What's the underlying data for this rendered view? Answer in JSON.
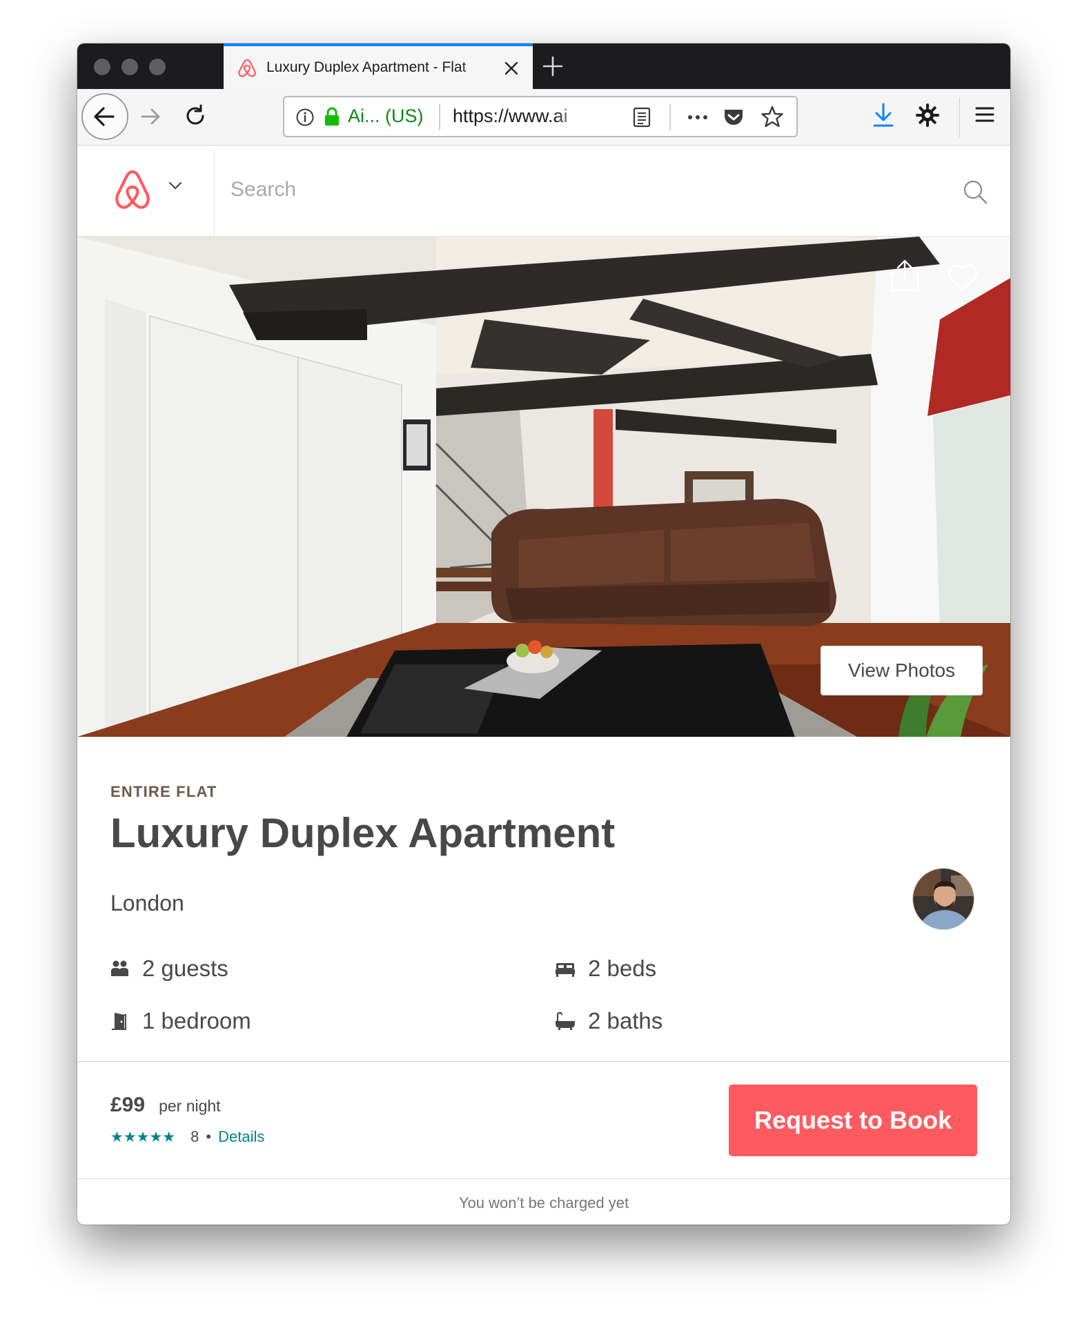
{
  "browser": {
    "tab_title": "Luxury Duplex Apartment - Flat",
    "url_identity": "Ai... (US)",
    "url_text": "https://www.ai"
  },
  "site": {
    "search_placeholder": "Search",
    "brand_color": "#FF5A5F"
  },
  "hero": {
    "view_photos_label": "View Photos"
  },
  "listing": {
    "type": "ENTIRE FLAT",
    "title": "Luxury Duplex Apartment",
    "city": "London",
    "amenities": {
      "guests": "2 guests",
      "beds": "2 beds",
      "bedroom": "1 bedroom",
      "baths": "2 baths"
    }
  },
  "booking": {
    "price": "£99",
    "price_unit": "per night",
    "stars": "★★★★★",
    "star_rating": 5,
    "review_count": "8",
    "separator": "•",
    "details_label": "Details",
    "book_label": "Request to Book",
    "footer_note": "You won’t be charged yet",
    "accent_color": "#008489"
  }
}
